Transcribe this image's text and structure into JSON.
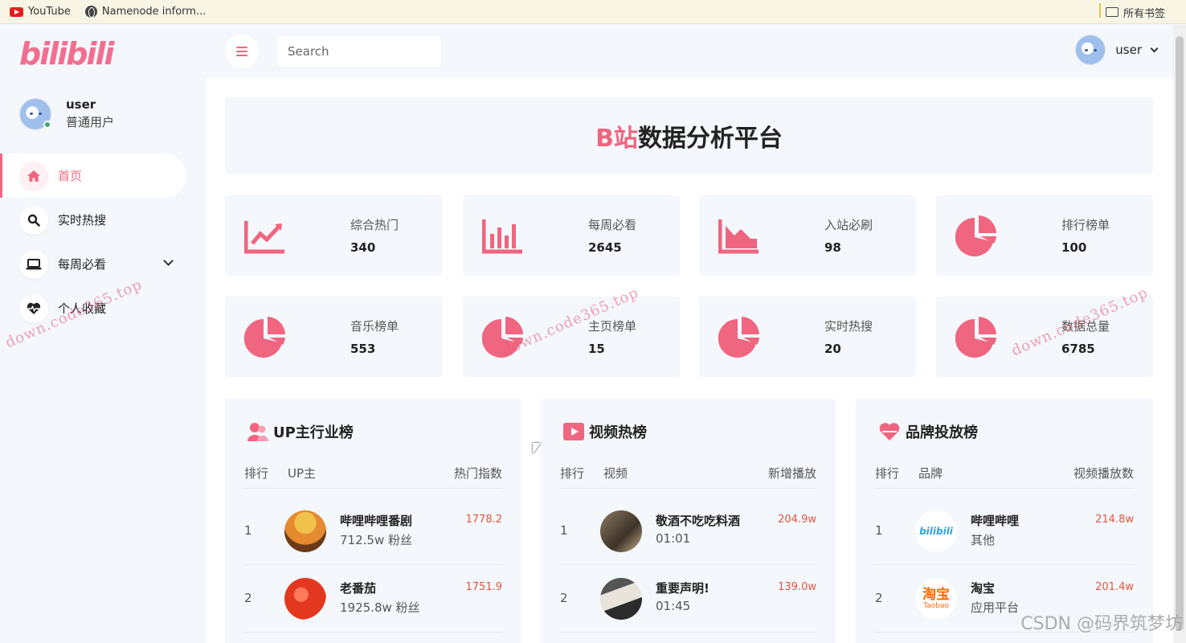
{
  "bookmarks": {
    "items": [
      "YouTube",
      "Namenode inform..."
    ],
    "all_bookmarks": "所有书签"
  },
  "sidebar": {
    "logo": "bilibili",
    "user_name": "user",
    "user_role": "普通用户",
    "items": [
      {
        "label": "首页",
        "icon": "home-icon",
        "active": true
      },
      {
        "label": "实时热搜",
        "icon": "search-icon"
      },
      {
        "label": "每周必看",
        "icon": "laptop-icon",
        "has_submenu": true
      },
      {
        "label": "个人收藏",
        "icon": "heart-pulse-icon"
      }
    ]
  },
  "header": {
    "search_placeholder": "Search",
    "user_name": "user"
  },
  "page": {
    "title_accent": "B站",
    "title_rest": "数据分析平台"
  },
  "stats": [
    {
      "label": "综合热门",
      "value": "340",
      "icon": "line-chart-icon"
    },
    {
      "label": "每周必看",
      "value": "2645",
      "icon": "bar-chart-icon"
    },
    {
      "label": "入站必刷",
      "value": "98",
      "icon": "area-chart-icon"
    },
    {
      "label": "排行榜单",
      "value": "100",
      "icon": "pie-chart-icon"
    },
    {
      "label": "音乐榜单",
      "value": "553",
      "icon": "pie-chart-icon"
    },
    {
      "label": "主页榜单",
      "value": "15",
      "icon": "pie-chart-icon"
    },
    {
      "label": "实时热搜",
      "value": "20",
      "icon": "pie-chart-icon"
    },
    {
      "label": "数据总量",
      "value": "6785",
      "icon": "pie-chart-icon"
    }
  ],
  "panels": [
    {
      "title": "UP主行业榜",
      "icon": "users-icon",
      "columns": [
        "排行",
        "UP主",
        "热门指数"
      ],
      "rows": [
        {
          "rank": "1",
          "name": "哔哩哔哩番剧",
          "sub": "712.5w 粉丝",
          "value": "1778.2"
        },
        {
          "rank": "2",
          "name": "老番茄",
          "sub": "1925.8w 粉丝",
          "value": "1751.9"
        }
      ]
    },
    {
      "title": "视频热榜",
      "icon": "play-icon",
      "columns": [
        "排行",
        "视频",
        "新增播放"
      ],
      "rows": [
        {
          "rank": "1",
          "name": "敬酒不吃吃料酒",
          "sub": "01:01",
          "value": "204.9w"
        },
        {
          "rank": "2",
          "name": "重要声明!",
          "sub": "01:45",
          "value": "139.0w"
        }
      ]
    },
    {
      "title": "品牌投放榜",
      "icon": "heart-icon",
      "columns": [
        "排行",
        "品牌",
        "视频播放数"
      ],
      "rows": [
        {
          "rank": "1",
          "name": "哔哩哔哩",
          "sub": "其他",
          "value": "214.8w",
          "logo_text": "bilibili"
        },
        {
          "rank": "2",
          "name": "淘宝",
          "sub": "应用平台",
          "value": "201.4w",
          "logo_text": "淘宝",
          "logo_sub": "Taobao"
        }
      ]
    }
  ],
  "watermark": "down.code365.top",
  "attribution": "CSDN @码界筑梦坊",
  "colors": {
    "accent": "#f0657f",
    "value_red": "#e2553e",
    "card_bg": "#f4f7fb"
  }
}
